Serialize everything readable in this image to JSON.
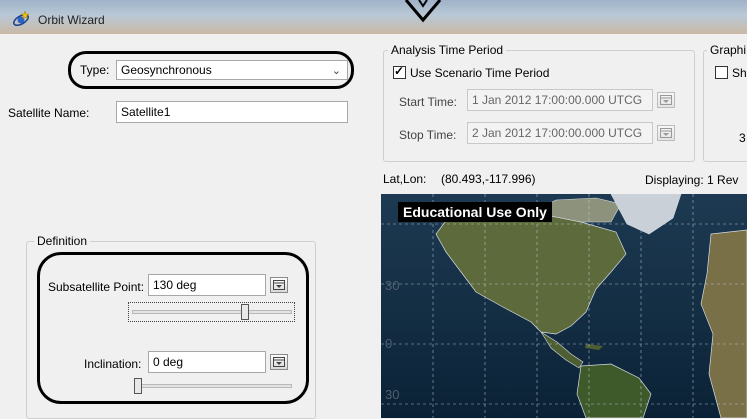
{
  "window": {
    "title": "Orbit Wizard"
  },
  "type_field": {
    "label": "Type:",
    "value": "Geosynchronous"
  },
  "satellite_name": {
    "label": "Satellite Name:",
    "value": "Satellite1"
  },
  "definition": {
    "title": "Definition",
    "subsatellite_point": {
      "label": "Subsatellite Point:",
      "value": "130 deg",
      "slider_fraction": 0.72
    },
    "inclination": {
      "label": "Inclination:",
      "value": "0 deg",
      "slider_fraction": 0.0
    }
  },
  "analysis_time": {
    "title": "Analysis Time Period",
    "use_scenario_label": "Use Scenario Time Period",
    "use_scenario_checked": true,
    "start_label": "Start Time:",
    "start_value": "1 Jan 2012 17:00:00.000 UTCG",
    "stop_label": "Stop Time:",
    "stop_value": "2 Jan 2012 17:00:00.000 UTCG"
  },
  "graphics": {
    "title": "Graphi",
    "show_label": "Sho",
    "show_checked": false,
    "value_partial": "3"
  },
  "status": {
    "latlon_label": "Lat,Lon:",
    "latlon_value": "(80.493,-117.996)",
    "displaying": "Displaying: 1 Rev"
  },
  "map": {
    "banner": "Educational Use Only",
    "lat_labels": [
      "30",
      "0",
      "30"
    ]
  },
  "colors": {
    "ocean": "#0f2a3f",
    "land": "#5d6b3c",
    "grid": "#c8d4e0"
  }
}
